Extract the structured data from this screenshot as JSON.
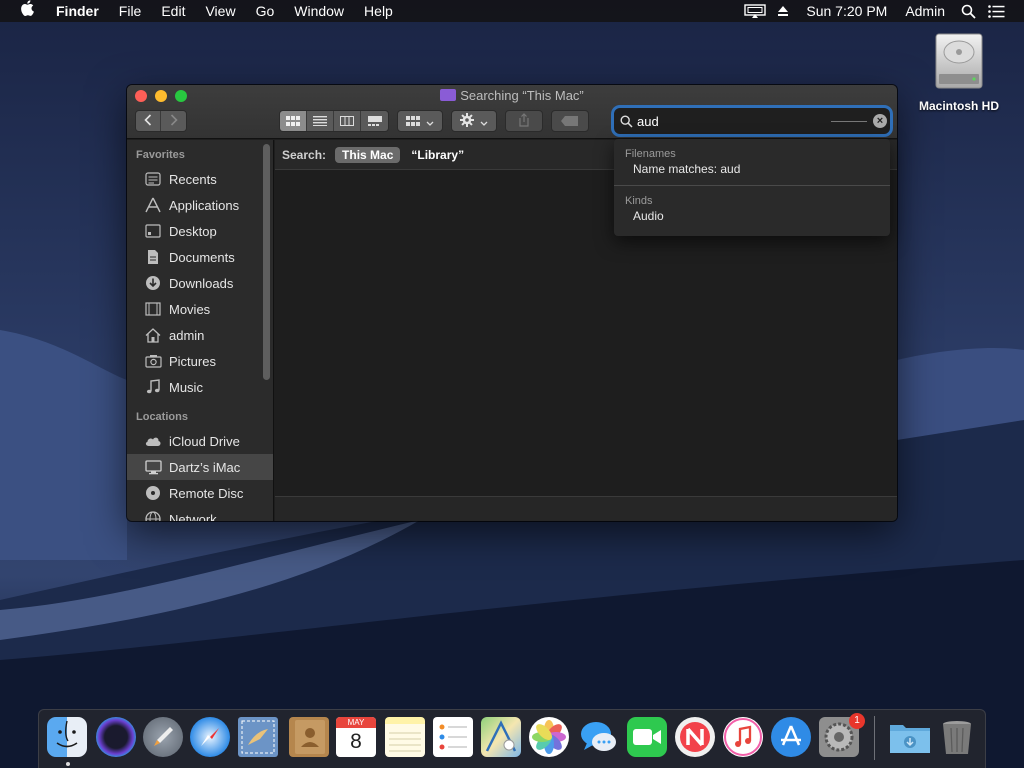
{
  "menubar": {
    "app_name": "Finder",
    "items": [
      "File",
      "Edit",
      "View",
      "Go",
      "Window",
      "Help"
    ],
    "clock": "Sun 7:20 PM",
    "user": "Admin"
  },
  "desktop": {
    "drive_label": "Macintosh HD"
  },
  "window": {
    "title": "Searching “This Mac”",
    "search": {
      "value": "aud"
    },
    "scope": {
      "label": "Search:",
      "active": "This Mac",
      "other": "“Library”"
    }
  },
  "sidebar": {
    "favorites_header": "Favorites",
    "favorites": [
      {
        "label": "Recents",
        "icon": "recents-icon"
      },
      {
        "label": "Applications",
        "icon": "applications-icon"
      },
      {
        "label": "Desktop",
        "icon": "desktop-icon"
      },
      {
        "label": "Documents",
        "icon": "documents-icon"
      },
      {
        "label": "Downloads",
        "icon": "downloads-icon"
      },
      {
        "label": "Movies",
        "icon": "movies-icon"
      },
      {
        "label": "admin",
        "icon": "home-icon"
      },
      {
        "label": "Pictures",
        "icon": "pictures-icon"
      },
      {
        "label": "Music",
        "icon": "music-icon"
      }
    ],
    "locations_header": "Locations",
    "locations": [
      {
        "label": "iCloud Drive",
        "icon": "icloud-icon"
      },
      {
        "label": "Dartz’s iMac",
        "icon": "imac-icon",
        "selected": true
      },
      {
        "label": "Remote Disc",
        "icon": "disc-icon"
      },
      {
        "label": "Network",
        "icon": "network-icon"
      }
    ]
  },
  "dropdown": {
    "section1_header": "Filenames",
    "section1_item": "Name matches: aud",
    "section2_header": "Kinds",
    "section2_item": "Audio"
  },
  "dock": {
    "apps": [
      {
        "name": "finder-icon"
      },
      {
        "name": "siri-icon"
      },
      {
        "name": "launchpad-icon"
      },
      {
        "name": "safari-icon"
      },
      {
        "name": "mail-icon"
      },
      {
        "name": "contacts-icon"
      },
      {
        "name": "calendar-icon"
      },
      {
        "name": "notes-icon"
      },
      {
        "name": "reminders-icon"
      },
      {
        "name": "maps-icon"
      },
      {
        "name": "photos-icon"
      },
      {
        "name": "messages-icon"
      },
      {
        "name": "facetime-icon"
      },
      {
        "name": "news-icon"
      },
      {
        "name": "itunes-icon"
      },
      {
        "name": "app-store-icon"
      },
      {
        "name": "system-preferences-icon"
      },
      {
        "name": "downloads-folder-icon"
      },
      {
        "name": "trash-icon"
      }
    ],
    "calendar_month": "MAY",
    "calendar_day": "8",
    "prefs_badge": "1"
  }
}
